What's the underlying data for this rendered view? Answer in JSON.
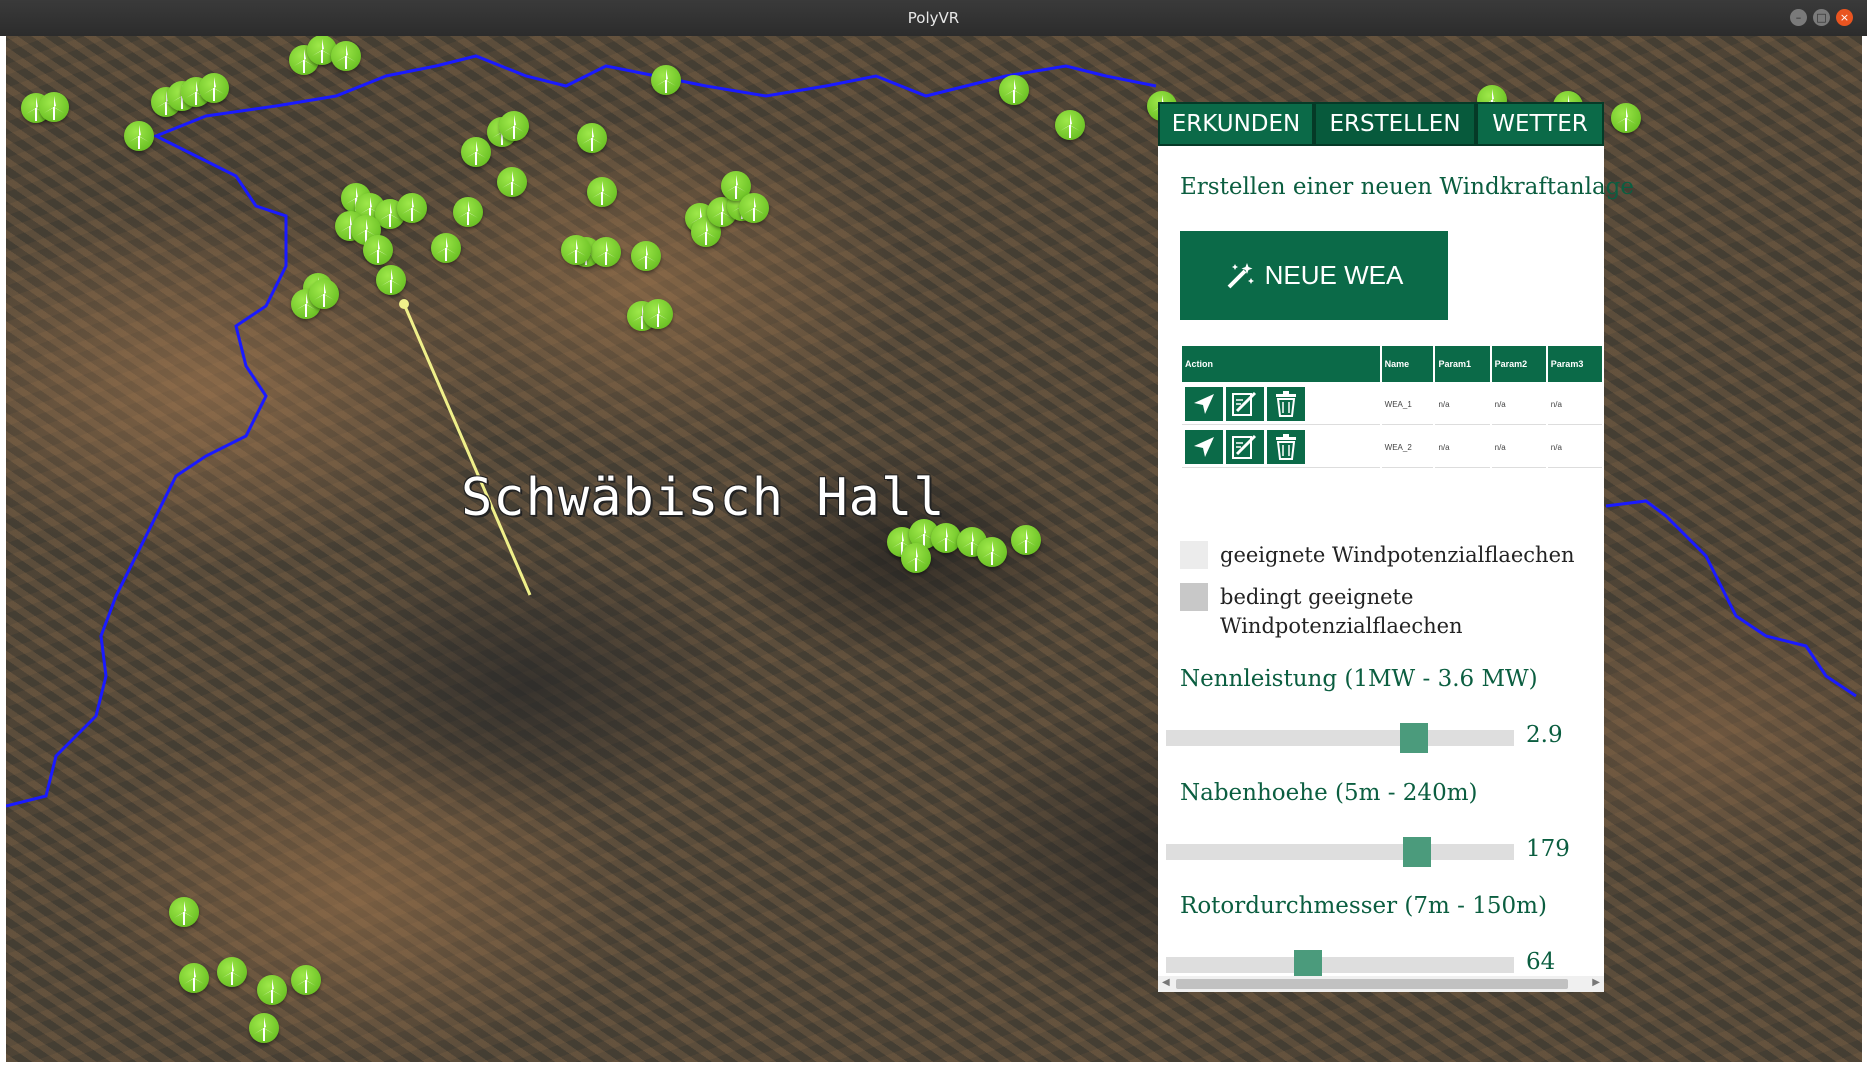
{
  "window": {
    "title": "PolyVR"
  },
  "map": {
    "city_label": "Schwäbisch Hall"
  },
  "panel": {
    "tabs": [
      {
        "label": "ERKUNDEN"
      },
      {
        "label": "ERSTELLEN"
      },
      {
        "label": "WETTER"
      }
    ],
    "title": "Erstellen einer neuen Windkraftanlage",
    "new_button": {
      "label": "NEUE WEA",
      "icon": "magic-wand-icon"
    },
    "table": {
      "headers": [
        "Action",
        "Name",
        "Param1",
        "Param2",
        "Param3"
      ],
      "rows": [
        {
          "name": "WEA_1",
          "param1": "n/a",
          "param2": "n/a",
          "param3": "n/a"
        },
        {
          "name": "WEA_2",
          "param1": "n/a",
          "param2": "n/a",
          "param3": "n/a"
        }
      ],
      "action_icons": [
        "navigate-icon",
        "edit-icon",
        "trash-icon"
      ]
    },
    "legend": [
      {
        "label": "geeignete Windpotenzialflaechen",
        "color": "#ececec"
      },
      {
        "label": "bedingt geeignete Windpotenzialflaechen",
        "color": "#c8c8c8"
      }
    ],
    "sliders": [
      {
        "label": "Nennleistung (1MW - 3.6 MW)",
        "value": "2.9",
        "min": 1,
        "max": 3.6,
        "num": 2.9
      },
      {
        "label": "Nabenhoehe (5m - 240m)",
        "value": "179",
        "min": 5,
        "max": 240,
        "num": 179
      },
      {
        "label": "Rotordurchmesser (7m - 150m)",
        "value": "64",
        "min": 7,
        "max": 150,
        "num": 64
      }
    ]
  },
  "colors": {
    "accent": "#0b6a48",
    "slider_thumb": "#4b9b7c",
    "border_line": "#1a1aff",
    "turbine": "#6ccf1e"
  }
}
